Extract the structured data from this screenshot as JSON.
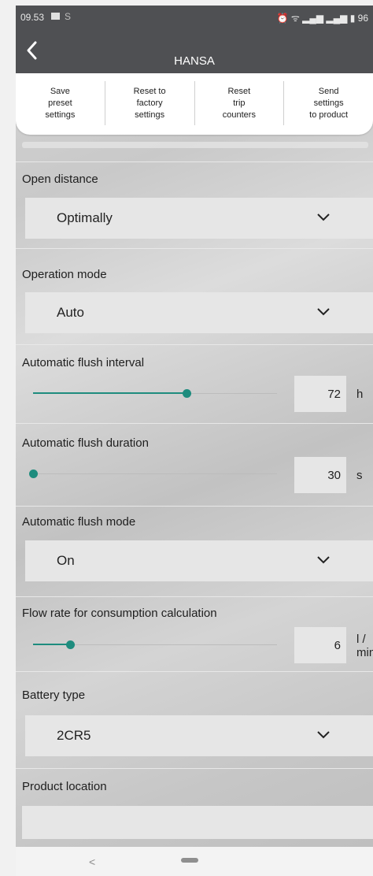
{
  "status": {
    "time": "09.53",
    "s_icon": "S",
    "right_icons": "⏰ ᯤ ▂▄▆ ▂▄▆ ▮ 96"
  },
  "appbar": {
    "title": "HANSA"
  },
  "actions": [
    {
      "label": "Save\npreset\nsettings"
    },
    {
      "label": "Reset to\nfactory\nsettings"
    },
    {
      "label": "Reset\ntrip\ncounters"
    },
    {
      "label": "Send\nsettings\nto product"
    }
  ],
  "settings": {
    "open_distance": {
      "label": "Open distance",
      "value": "Optimally"
    },
    "operation_mode": {
      "label": "Operation mode",
      "value": "Auto"
    },
    "flush_interval": {
      "label": "Automatic flush interval",
      "value": "72",
      "unit": "h",
      "fraction": 0.63
    },
    "flush_duration": {
      "label": "Automatic flush duration",
      "value": "30",
      "unit": "s",
      "fraction": 0.0
    },
    "flush_mode": {
      "label": "Automatic flush mode",
      "value": "On"
    },
    "flow_rate": {
      "label": "Flow rate for consumption calculation",
      "value": "6",
      "unit": "l /\nmin",
      "fraction": 0.15
    },
    "battery_type": {
      "label": "Battery type",
      "value": "2CR5"
    },
    "product_location": {
      "label": "Product location",
      "value": ""
    }
  },
  "navbar": {
    "back": "<"
  },
  "colors": {
    "accent": "#1e8c7e",
    "bar": "#4f5053"
  }
}
